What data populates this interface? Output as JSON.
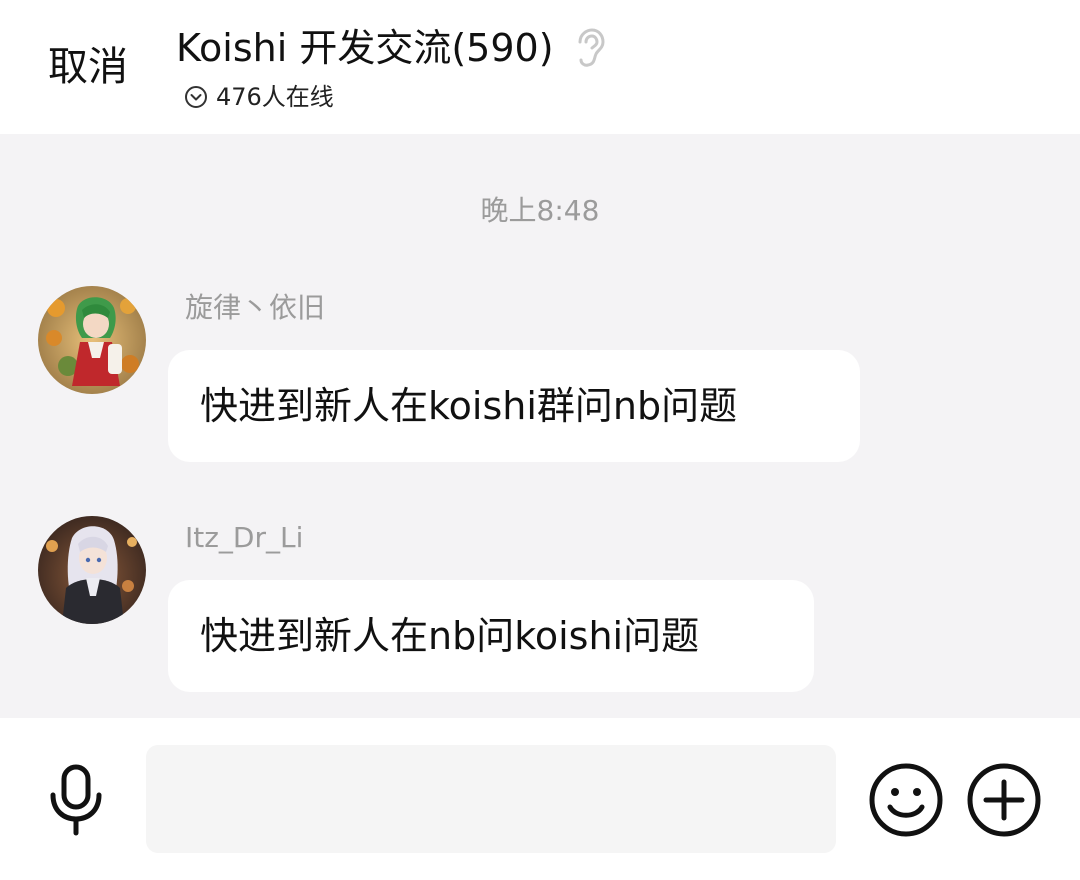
{
  "header": {
    "cancel_label": "取消",
    "title": "Koishi 开发交流(590)",
    "online_text": "476人在线",
    "ear_icon": "ear-icon",
    "chevron_icon": "chevron-down-circle-icon"
  },
  "chat": {
    "timestamp": "晚上8:48",
    "messages": [
      {
        "sender": "旋律丶依旧",
        "text": "快进到新人在koishi群问nb问题",
        "avatar": "avatar-green-hair-character"
      },
      {
        "sender": "Itz_Dr_Li",
        "text": "快进到新人在nb问koishi问题",
        "avatar": "avatar-white-hair-character"
      }
    ]
  },
  "input_bar": {
    "placeholder": "",
    "value": "",
    "mic_icon": "microphone-icon",
    "emoji_icon": "smiley-icon",
    "plus_icon": "plus-circle-icon"
  },
  "colors": {
    "background": "#f4f3f5",
    "header_bg": "#ffffff",
    "bubble_bg": "#ffffff",
    "secondary_text": "#9b9b9b",
    "primary_text": "#111111",
    "input_bg": "#f5f5f5"
  }
}
